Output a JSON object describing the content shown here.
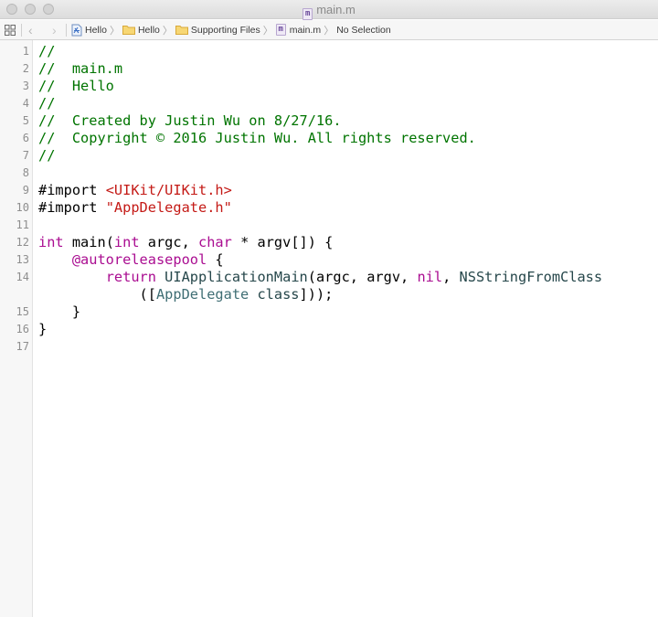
{
  "window": {
    "title": "main.m",
    "title_icon": "objc-m-file-icon"
  },
  "jumpbar": {
    "breadcrumbs": [
      {
        "label": "Hello",
        "icon": "xcode-project-icon"
      },
      {
        "label": "Hello",
        "icon": "folder-icon"
      },
      {
        "label": "Supporting Files",
        "icon": "folder-icon"
      },
      {
        "label": "main.m",
        "icon": "objc-m-file-icon"
      },
      {
        "label": "No Selection",
        "icon": ""
      }
    ],
    "chevron": "〉"
  },
  "editor": {
    "line_numbers": [
      "1",
      "2",
      "3",
      "4",
      "5",
      "6",
      "7",
      "8",
      "9",
      "10",
      "11",
      "12",
      "13",
      "14",
      "",
      "15",
      "16",
      "17"
    ],
    "lines": [
      [
        {
          "text": "//",
          "style": "c"
        }
      ],
      [
        {
          "text": "//  main.m",
          "style": "c"
        }
      ],
      [
        {
          "text": "//  Hello",
          "style": "c"
        }
      ],
      [
        {
          "text": "//",
          "style": "c"
        }
      ],
      [
        {
          "text": "//  Created by Justin Wu on 8/27/16.",
          "style": "c"
        }
      ],
      [
        {
          "text": "//  Copyright © 2016 Justin Wu. All rights reserved.",
          "style": "c"
        }
      ],
      [
        {
          "text": "//",
          "style": "c"
        }
      ],
      [
        {
          "text": "",
          "style": ""
        }
      ],
      [
        {
          "text": "#import ",
          "style": ""
        },
        {
          "text": "<UIKit/UIKit.h>",
          "style": "s"
        }
      ],
      [
        {
          "text": "#import ",
          "style": ""
        },
        {
          "text": "\"AppDelegate.h\"",
          "style": "s"
        }
      ],
      [
        {
          "text": "",
          "style": ""
        }
      ],
      [
        {
          "text": "int",
          "style": "k"
        },
        {
          "text": " main(",
          "style": ""
        },
        {
          "text": "int",
          "style": "k"
        },
        {
          "text": " argc, ",
          "style": ""
        },
        {
          "text": "char",
          "style": "k"
        },
        {
          "text": " * argv[]) {",
          "style": ""
        }
      ],
      [
        {
          "text": "    ",
          "style": ""
        },
        {
          "text": "@autoreleasepool",
          "style": "k"
        },
        {
          "text": " {",
          "style": ""
        }
      ],
      [
        {
          "text": "        ",
          "style": ""
        },
        {
          "text": "return",
          "style": "k"
        },
        {
          "text": " ",
          "style": ""
        },
        {
          "text": "UIApplicationMain",
          "style": "f"
        },
        {
          "text": "(argc, argv, ",
          "style": ""
        },
        {
          "text": "nil",
          "style": "k"
        },
        {
          "text": ", ",
          "style": ""
        },
        {
          "text": "NSStringFromClass",
          "style": "f"
        }
      ],
      [
        {
          "text": "            ([",
          "style": ""
        },
        {
          "text": "AppDelegate",
          "style": "t"
        },
        {
          "text": " ",
          "style": ""
        },
        {
          "text": "class",
          "style": "f"
        },
        {
          "text": "]));",
          "style": ""
        }
      ],
      [
        {
          "text": "    }",
          "style": ""
        }
      ],
      [
        {
          "text": "}",
          "style": ""
        }
      ],
      [
        {
          "text": "",
          "style": ""
        }
      ]
    ]
  }
}
